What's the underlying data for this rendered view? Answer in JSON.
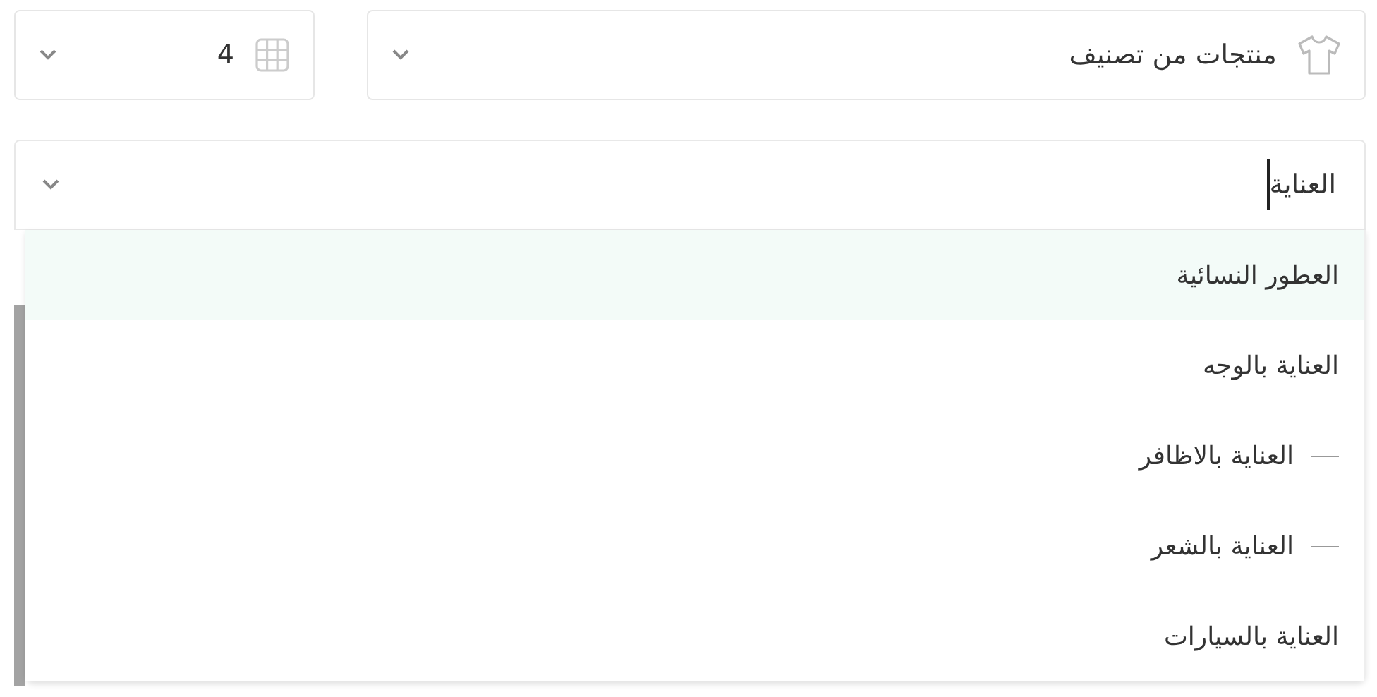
{
  "category_select": {
    "value": "منتجات من تصنيف"
  },
  "columns_select": {
    "value": "4"
  },
  "search_select": {
    "value": "العناية",
    "focused": true
  },
  "options": [
    {
      "label": "العطور النسائية",
      "highlighted": true
    },
    {
      "label": "العناية بالوجه",
      "highlighted": false,
      "children": [
        {
          "label": "العناية بالاظافر",
          "highlighted": false
        },
        {
          "label": "العناية بالشعر",
          "highlighted": false
        }
      ]
    },
    {
      "label": "العناية بالسيارات",
      "highlighted": false
    }
  ]
}
